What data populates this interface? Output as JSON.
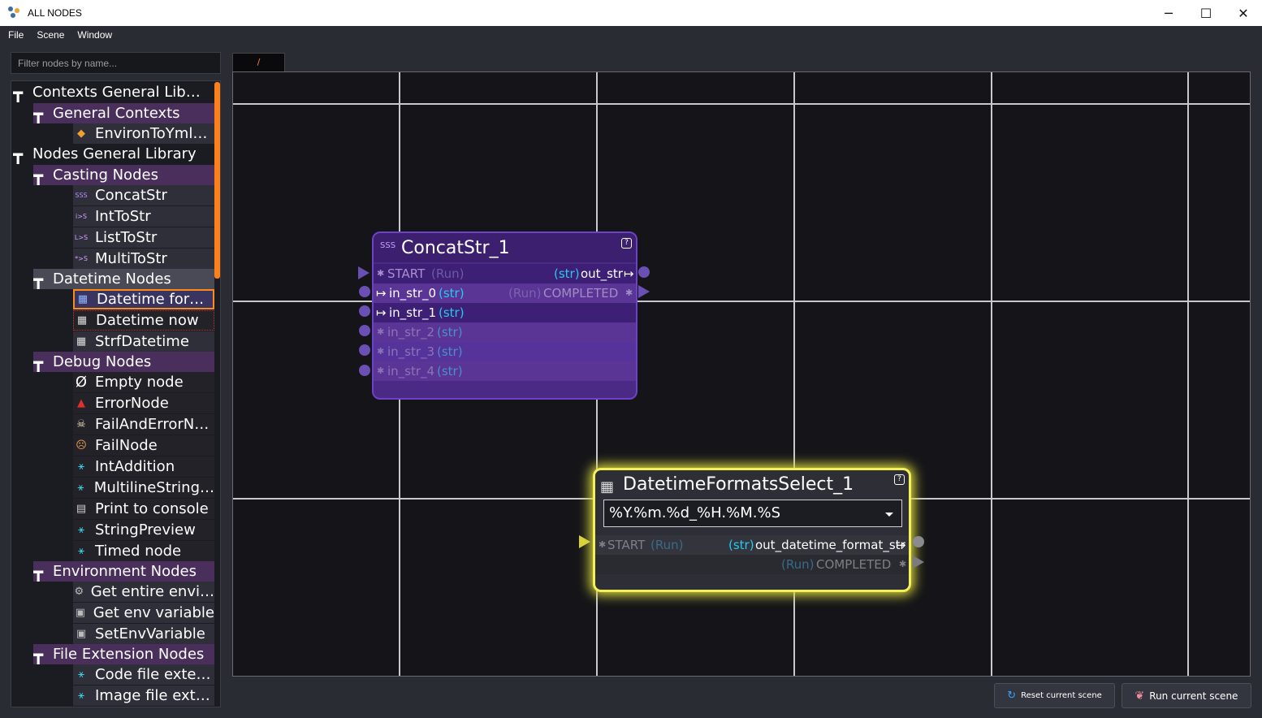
{
  "window": {
    "title": "ALL NODES",
    "controls": [
      "─",
      "☐",
      "✕"
    ]
  },
  "menu": [
    "File",
    "Scene",
    "Window"
  ],
  "filter": {
    "placeholder": "Filter nodes by name..."
  },
  "tree": {
    "rows": [
      {
        "label": "Contexts General Lib…",
        "level": 0
      },
      {
        "label": "General Contexts",
        "level": 1
      },
      {
        "label": "EnvironToYml…",
        "level": 2,
        "icon": "cubes-icon"
      },
      {
        "label": "Nodes General Library",
        "level": 0
      },
      {
        "label": "Casting Nodes",
        "level": 1
      },
      {
        "label": "ConcatStr",
        "level": 2,
        "icon": "sss-icon"
      },
      {
        "label": "IntToStr",
        "level": 2,
        "icon": "int-to-str-icon"
      },
      {
        "label": "ListToStr",
        "level": 2,
        "icon": "list-to-str-icon"
      },
      {
        "label": "MultiToStr",
        "level": 2,
        "icon": "multi-to-str-icon"
      },
      {
        "label": "Datetime Nodes",
        "level": 1
      },
      {
        "label": "Datetime for…",
        "level": 2,
        "icon": "calendar-icon"
      },
      {
        "label": "Datetime now",
        "level": 2,
        "icon": "calendar-icon"
      },
      {
        "label": "StrfDatetime",
        "level": 2,
        "icon": "calendar-icon"
      },
      {
        "label": "Debug Nodes",
        "level": 1
      },
      {
        "label": "Empty node",
        "level": 2,
        "icon": "empty-set-icon"
      },
      {
        "label": "ErrorNode",
        "level": 2,
        "icon": "warning-icon"
      },
      {
        "label": "FailAndErrorN…",
        "level": 2,
        "icon": "skull-icon"
      },
      {
        "label": "FailNode",
        "level": 2,
        "icon": "sad-face-icon"
      },
      {
        "label": "IntAddition",
        "level": 2,
        "icon": "graph-icon"
      },
      {
        "label": "MultilineString…",
        "level": 2,
        "icon": "graph-icon"
      },
      {
        "label": "Print to console",
        "level": 2,
        "icon": "printer-icon"
      },
      {
        "label": "StringPreview",
        "level": 2,
        "icon": "graph-icon"
      },
      {
        "label": "Timed node",
        "level": 2,
        "icon": "graph-icon"
      },
      {
        "label": "Environment Nodes",
        "level": 1
      },
      {
        "label": "Get entire envi…",
        "level": 2,
        "icon": "gear-icon"
      },
      {
        "label": "Get env variable",
        "level": 2,
        "icon": "env-var-icon"
      },
      {
        "label": "SetEnvVariable",
        "level": 2,
        "icon": "env-var-icon"
      },
      {
        "label": "File Extension Nodes",
        "level": 1
      },
      {
        "label": "Code file exte…",
        "level": 2,
        "icon": "graph-icon"
      },
      {
        "label": "Image file ext…",
        "level": 2,
        "icon": "graph-icon"
      }
    ]
  },
  "canvas": {
    "tab_label": "/"
  },
  "node_concat": {
    "title": "ConcatStr_1",
    "icon_text": "SSS",
    "help": "?",
    "start": "START",
    "start_type": "(Run)",
    "out_type": "(str)",
    "out_name": "out_str",
    "completed_type": "(Run)",
    "completed": "COMPLETED",
    "inputs": [
      {
        "name": "in_str_0",
        "type": "(str)"
      },
      {
        "name": "in_str_1",
        "type": "(str)"
      },
      {
        "name": "in_str_2",
        "type": "(str)"
      },
      {
        "name": "in_str_3",
        "type": "(str)"
      },
      {
        "name": "in_str_4",
        "type": "(str)"
      }
    ]
  },
  "node_datetime": {
    "title": "DatetimeFormatsSelect_1",
    "help": "?",
    "selected_format": "%Y.%m.%d_%H.%M.%S",
    "start": "START",
    "start_type": "(Run)",
    "out_type": "(str)",
    "out_name": "out_datetime_format_str",
    "completed_type": "(Run)",
    "completed": "COMPLETED"
  },
  "buttons": {
    "reset": "Reset current scene",
    "run": "Run current scene"
  }
}
